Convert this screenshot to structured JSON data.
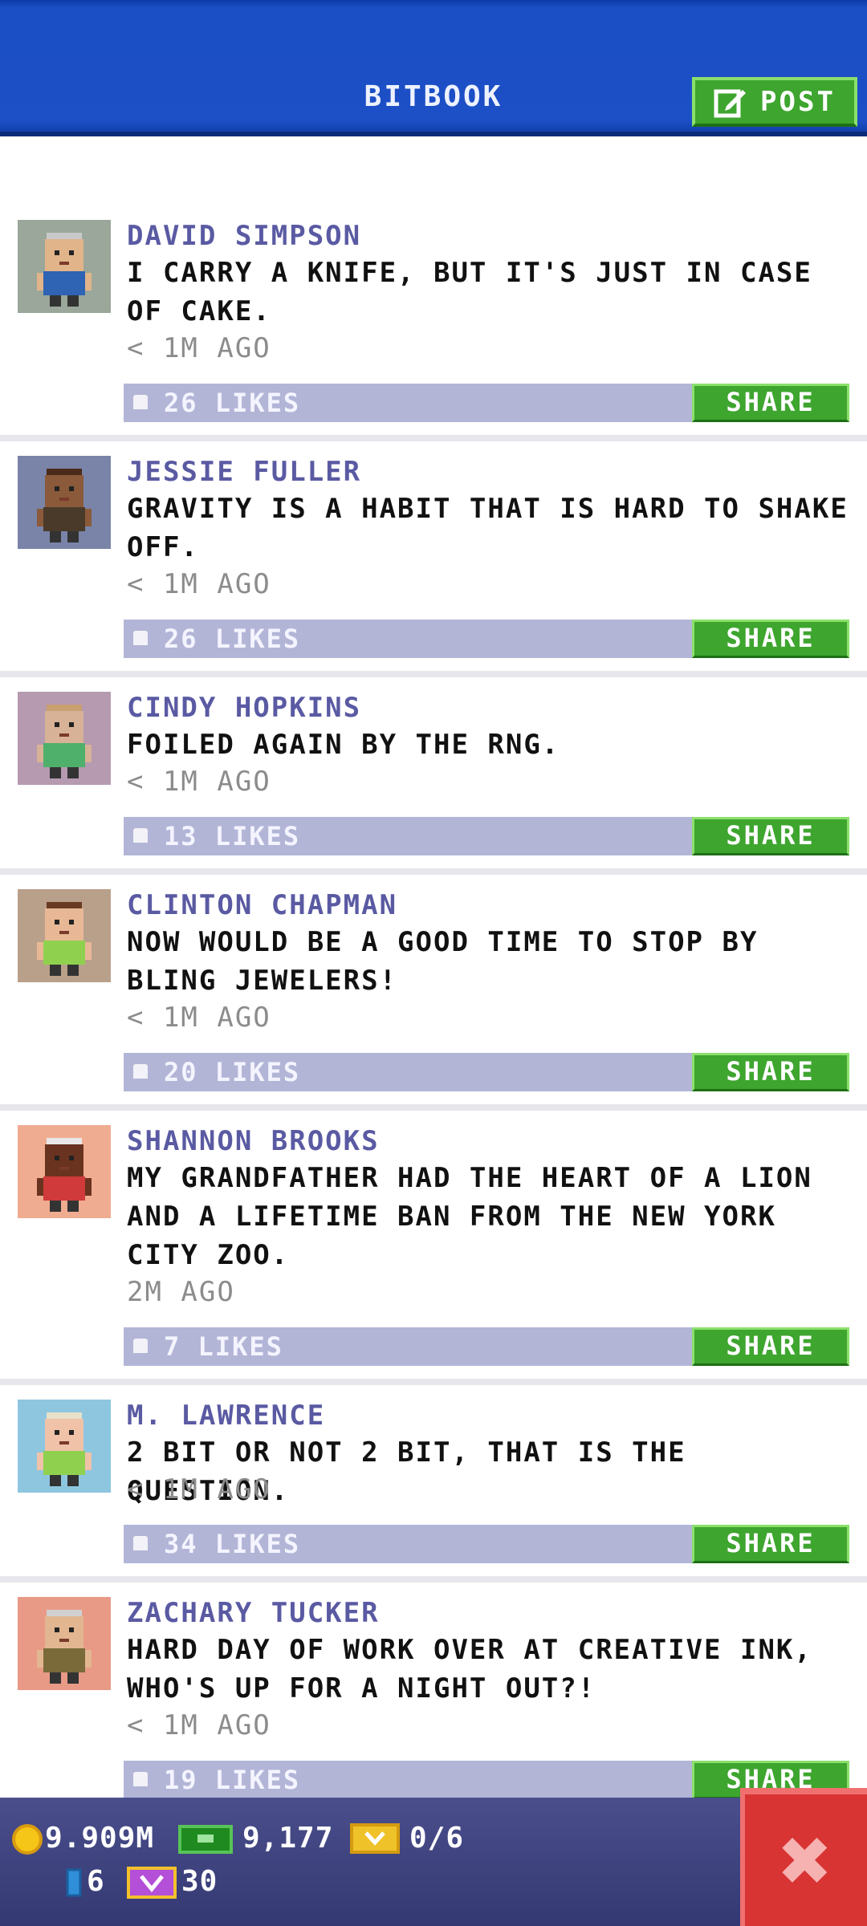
{
  "header": {
    "title": "BITBOOK",
    "post_label": "POST"
  },
  "colors": {
    "header_blue": "#1d4fc6",
    "share_green": "#3ea52f",
    "likes_bar": "#b3b5d7",
    "name_purple": "#5a5aa3",
    "close_red": "#d83434"
  },
  "posts": [
    {
      "name": "DAVID SIMPSON",
      "message": "I CARRY A KNIFE, BUT IT'S JUST IN CASE OF CAKE.",
      "time": "< 1M AGO",
      "likes": "26 LIKES",
      "share": "SHARE",
      "avatar_bg": "#9aa79a",
      "skin": "#e1b48a",
      "hair": "#c9c9c9",
      "shirt": "#2f63b3"
    },
    {
      "name": "JESSIE FULLER",
      "message": "GRAVITY IS A HABIT THAT IS HARD TO SHAKE OFF.",
      "time": "< 1M AGO",
      "likes": "26 LIKES",
      "share": "SHARE",
      "avatar_bg": "#7a84a8",
      "skin": "#8a5a3a",
      "hair": "#4a2a1a",
      "shirt": "#4a3a2a"
    },
    {
      "name": "CINDY HOPKINS",
      "message": "FOILED AGAIN BY THE RNG.",
      "time": "< 1M AGO",
      "likes": "13 LIKES",
      "share": "SHARE",
      "avatar_bg": "#b59ab0",
      "skin": "#d8b296",
      "hair": "#c9a070",
      "shirt": "#4fb06b"
    },
    {
      "name": "CLINTON CHAPMAN",
      "message": "NOW WOULD BE A GOOD TIME TO STOP BY BLING JEWELERS!",
      "time": "< 1M AGO",
      "likes": "20 LIKES",
      "share": "SHARE",
      "avatar_bg": "#b9a08a",
      "skin": "#e8b896",
      "hair": "#6a3a22",
      "shirt": "#8fd14f"
    },
    {
      "name": "SHANNON BROOKS",
      "message": "MY GRANDFATHER HAD THE HEART OF A LION AND A LIFETIME BAN FROM THE NEW YORK CITY ZOO.",
      "time": "2M AGO",
      "likes": "7 LIKES",
      "share": "SHARE",
      "avatar_bg": "#f0ac90",
      "skin": "#6a3320",
      "hair": "#e8e8e8",
      "shirt": "#d03a3a"
    },
    {
      "name": "M. LAWRENCE",
      "message": "2 BIT OR NOT 2 BIT, THAT IS THE QUESTION.",
      "time": "< 1M AGO",
      "likes": "34 LIKES",
      "share": "SHARE",
      "avatar_bg": "#8ec6e0",
      "skin": "#f0c2a8",
      "hair": "#e8e0c8",
      "shirt": "#8fd14f"
    },
    {
      "name": "ZACHARY TUCKER",
      "message": "HARD DAY OF WORK OVER AT CREATIVE INK, WHO'S UP FOR A NIGHT OUT?!",
      "time": "< 1M AGO",
      "likes": "19 LIKES",
      "share": "SHARE",
      "avatar_bg": "#e89a86",
      "skin": "#e2b690",
      "hair": "#d0d0d0",
      "shirt": "#7a6a3a"
    }
  ],
  "footer": {
    "coins": "9.909M",
    "bux": "9,177",
    "tickets": "0/6",
    "blue_count": "6",
    "vip_count": "30"
  }
}
